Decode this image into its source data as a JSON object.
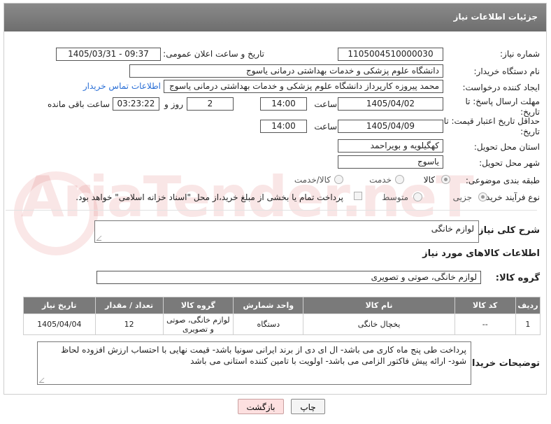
{
  "header": {
    "title": "جزئیات اطلاعات نیاز"
  },
  "watermark": "AriaTender.neT",
  "fields": {
    "need_number_label": "شماره نیاز:",
    "need_number": "1105004510000030",
    "announce_label": "تاریخ و ساعت اعلان عمومی:",
    "announce_value": "1405/03/31 - 09:37",
    "buyer_org_label": "نام دستگاه خریدار:",
    "buyer_org": "دانشگاه علوم پزشکی و خدمات بهداشتی  درمانی یاسوج",
    "creator_label": "ایجاد کننده درخواست:",
    "creator": "محمد پیروزه کارپرداز دانشگاه علوم پزشکی و خدمات بهداشتی  درمانی یاسوج",
    "contact_link": "اطلاعات تماس خریدار",
    "reply_deadline_label": "مهلت ارسال پاسخ: تا تاریخ:",
    "reply_date": "1405/04/02",
    "time_label": "ساعت",
    "reply_time": "14:00",
    "days_value": "2",
    "days_label": "روز و",
    "remaining_time": "03:23:22",
    "remaining_label": "ساعت باقی مانده",
    "price_deadline_label": "حداقل تاریخ اعتبار قیمت: تا تاریخ:",
    "price_date": "1405/04/09",
    "price_time": "14:00",
    "province_label": "استان محل تحویل:",
    "province": "کهگیلویه و بویراحمد",
    "city_label": "شهر محل تحویل:",
    "city": "یاسوج",
    "category_label": "طبقه بندی موضوعی:",
    "category_options": [
      "کالا",
      "خدمت",
      "کالا/خدمت"
    ],
    "process_label": "نوع فرآیند خرید :",
    "process_options": [
      "جزیی",
      "متوسط"
    ],
    "payment_note": "پرداخت تمام یا بخشی از مبلغ خرید،از محل \"اسناد خزانه اسلامی\" خواهد بود."
  },
  "summary": {
    "label": "شرح کلی نیاز:",
    "value": "لوازم خانگی"
  },
  "goods_section": {
    "title": "اطلاعات کالاهای مورد نیاز",
    "group_label": "گروه کالا:",
    "group_value": "لوازم خانگی، صوتی و تصویری"
  },
  "table": {
    "headers": [
      "ردیف",
      "کد کالا",
      "نام کالا",
      "واحد شمارش",
      "گروه کالا",
      "تعداد / مقدار",
      "تاریخ نیاز"
    ],
    "rows": [
      [
        "1",
        "--",
        "یخچال خانگی",
        "دستگاه",
        "لوازم خانگی، صوتی و تصویری",
        "12",
        "1405/04/04"
      ]
    ]
  },
  "buyer_notes": {
    "label": "توضیحات خریدار:",
    "value": "پرداخت طی پنج ماه کاری می باشد- ال ای دی از برند ایرانی سونیا باشد- قیمت نهایی با احتساب ارزش افزوده لحاظ شود- ارائه پیش فاکتور الزامی می باشد- اولویت با تامین کننده استانی می باشد"
  },
  "buttons": {
    "print": "چاپ",
    "back": "بازگشت"
  }
}
